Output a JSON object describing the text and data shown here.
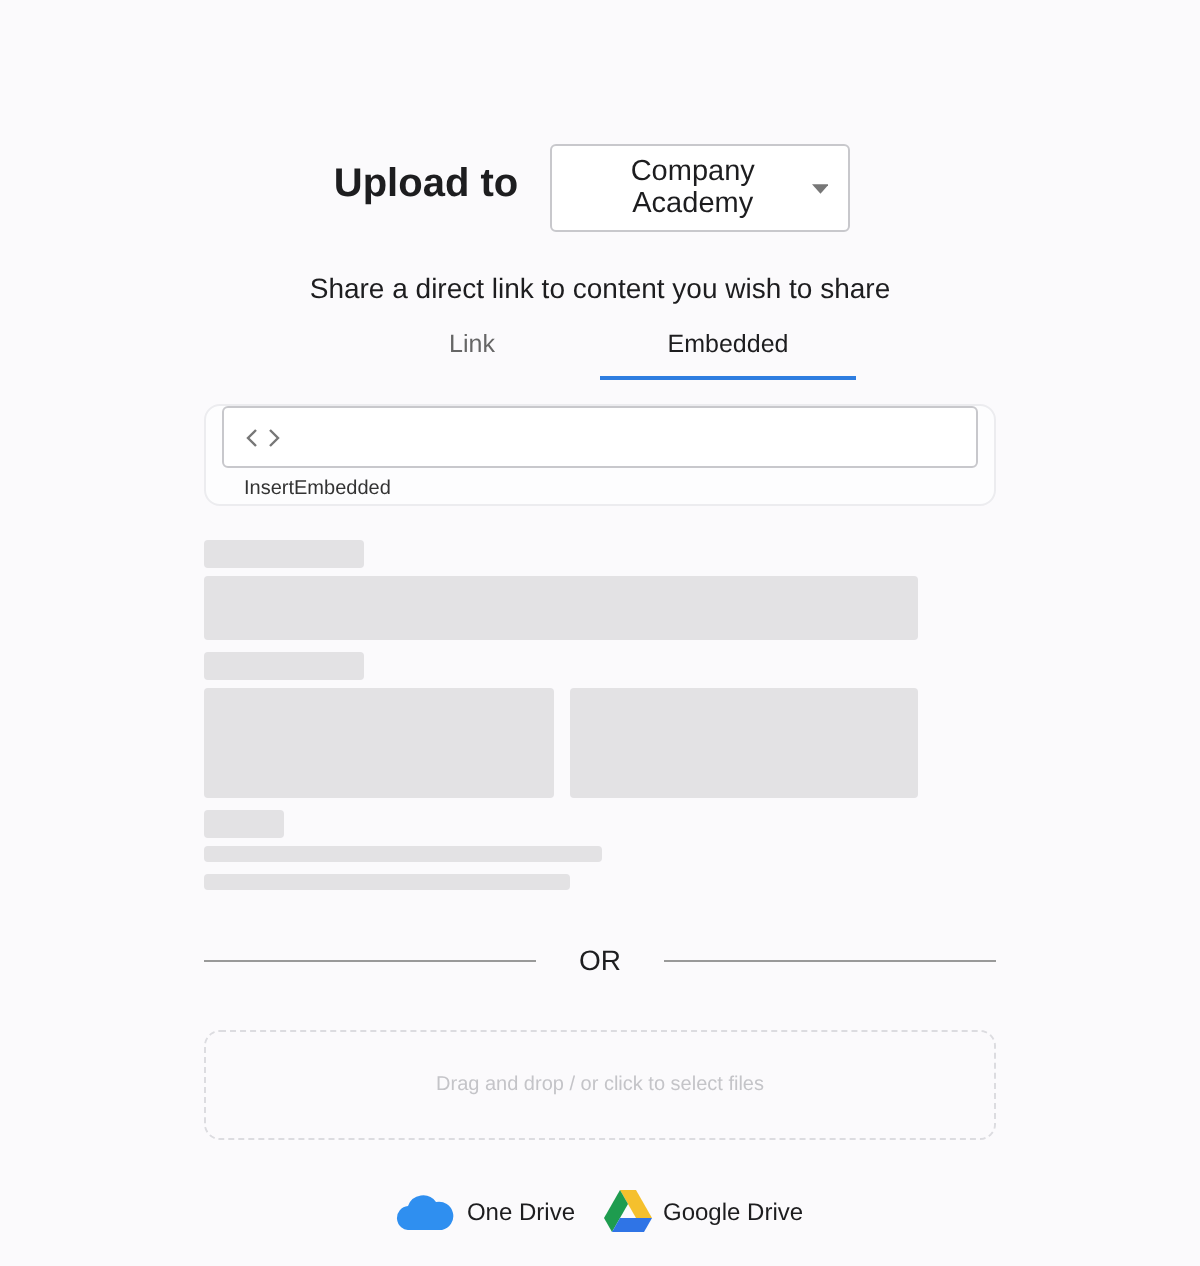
{
  "header": {
    "title": "Upload to",
    "destination": "Company Academy"
  },
  "subtitle": "Share a direct link to content you wish to share",
  "tabs": [
    {
      "label": "Link",
      "selected": false
    },
    {
      "label": "Embedded",
      "selected": true
    }
  ],
  "embed": {
    "label": "InsertEmbedded"
  },
  "divider": "OR",
  "dropzone": {
    "text": "Drag and drop / or click to select files"
  },
  "sources": [
    {
      "kind": "onedrive",
      "label": "One Drive"
    },
    {
      "kind": "gdrive",
      "label": "Google Drive"
    }
  ]
}
